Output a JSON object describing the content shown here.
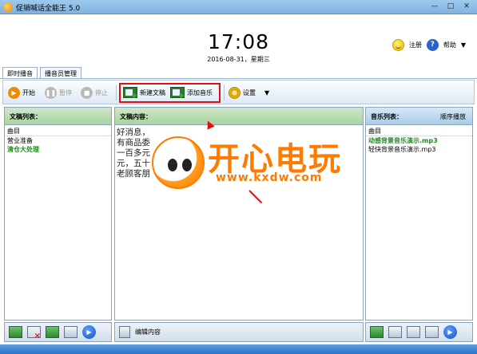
{
  "window": {
    "title": "促销喊话全能王 5.0"
  },
  "clock": {
    "time": "17:08",
    "date": "2016-08-31，星期三"
  },
  "header": {
    "register_label": "注册",
    "help_label": "帮助"
  },
  "tabs": [
    {
      "label": "即时播音"
    },
    {
      "label": "播音员管理"
    }
  ],
  "toolbar": {
    "start_label": "开始",
    "pause_label": "暂停",
    "stop_label": "停止",
    "new_draft_label": "新建文稿",
    "add_music_label": "添加音乐",
    "settings_label": "设置"
  },
  "draft_list": {
    "title": "文稿列表：",
    "column": "曲目",
    "items": [
      "营业准备",
      "清仓大处理"
    ]
  },
  "draft_content": {
    "title": "文稿内容：",
    "lines": [
      "好消息，",
      "有商品委",
      "一百多元",
      "元，五十",
      "老顾客朋"
    ],
    "edit_label": "编辑内容"
  },
  "music_list": {
    "title": "音乐列表：",
    "play_mode": "顺序播放",
    "column": "曲目",
    "items": [
      "动感背景音乐演示.mp3",
      "轻快背景音乐演示.mp3"
    ]
  },
  "watermark": {
    "title": "开心电玩",
    "url": "www.kxdw.com"
  },
  "colors": {
    "accent_red": "#e01010",
    "green_text": "#1e8a1e",
    "watermark_orange": "#ff7a00"
  }
}
